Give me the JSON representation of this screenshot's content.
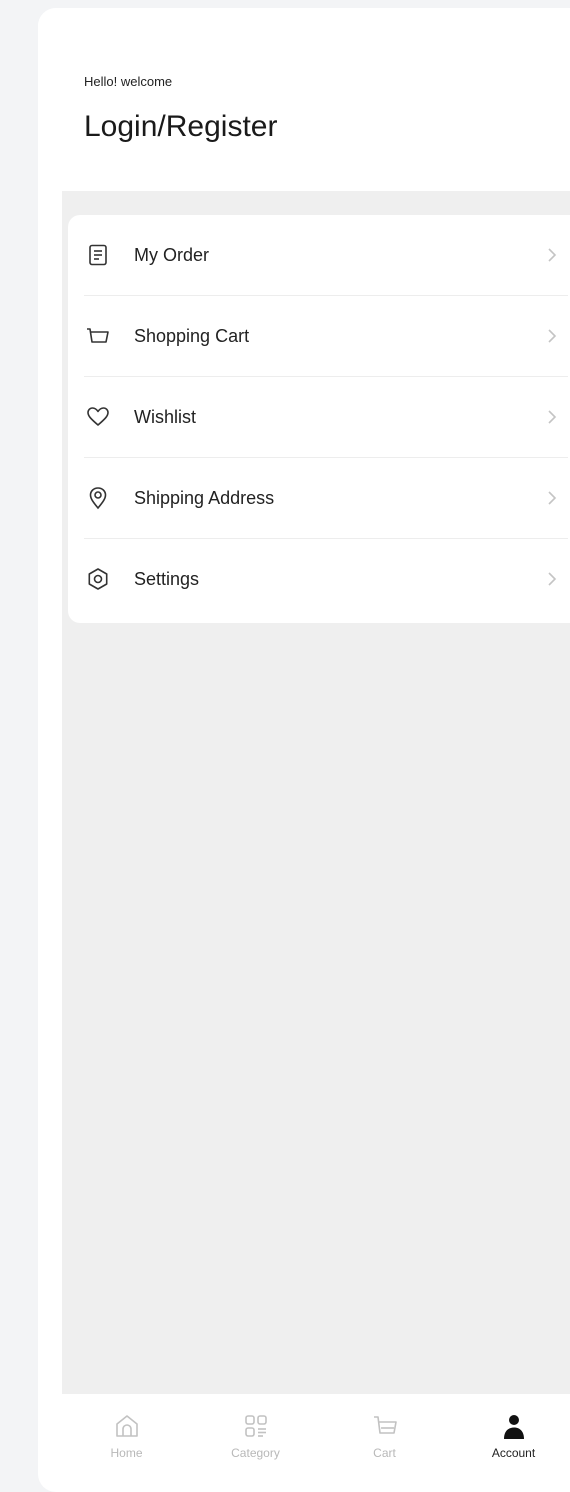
{
  "header": {
    "greeting": "Hello! welcome",
    "login_label": "Login/Register"
  },
  "menu": {
    "items": [
      {
        "label": "My Order",
        "icon": "order-list-icon"
      },
      {
        "label": "Shopping Cart",
        "icon": "cart-icon"
      },
      {
        "label": "Wishlist",
        "icon": "heart-icon"
      },
      {
        "label": "Shipping Address",
        "icon": "location-pin-icon"
      },
      {
        "label": "Settings",
        "icon": "gear-icon"
      }
    ]
  },
  "tabbar": {
    "tabs": [
      {
        "label": "Home",
        "icon": "home-icon",
        "active": false
      },
      {
        "label": "Category",
        "icon": "category-grid-icon",
        "active": false
      },
      {
        "label": "Cart",
        "icon": "cart-icon",
        "active": false
      },
      {
        "label": "Account",
        "icon": "user-icon",
        "active": true
      }
    ]
  },
  "colors": {
    "page_background": "#f3f4f6",
    "content_background": "#efefef",
    "card_background": "#ffffff",
    "inactive_tab": "#b8b8b8",
    "active_tab": "#222222"
  }
}
